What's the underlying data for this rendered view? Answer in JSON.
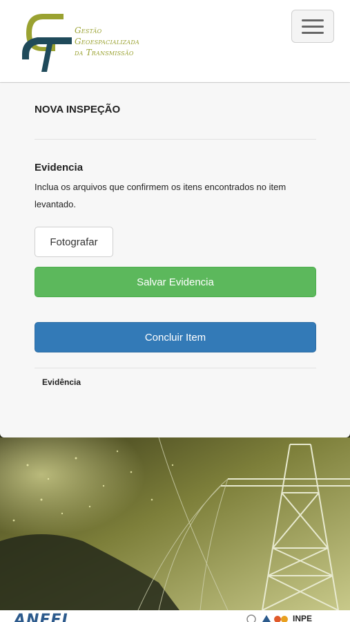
{
  "header": {
    "logo_lines": [
      "Gestão",
      "Geoespacializada",
      "da Transmissão"
    ]
  },
  "card": {
    "title": "NOVA INSPEÇÃO",
    "evidence_title": "Evidencia",
    "evidence_description": "Inclua os arquivos que confirmem os itens encontrados no item levantado.",
    "photo_button": "Fotografar",
    "save_button": "Salvar Evidencia",
    "finish_button": "Concluir Item",
    "evidence_list_label": "Evidência"
  },
  "footer": {
    "left_logo_text": "ANEEL",
    "right_logo_text": "INPE"
  },
  "colors": {
    "brand_olive": "#9aa231",
    "brand_teal": "#1f4a5a",
    "success": "#5cb85c",
    "primary": "#337ab7"
  }
}
